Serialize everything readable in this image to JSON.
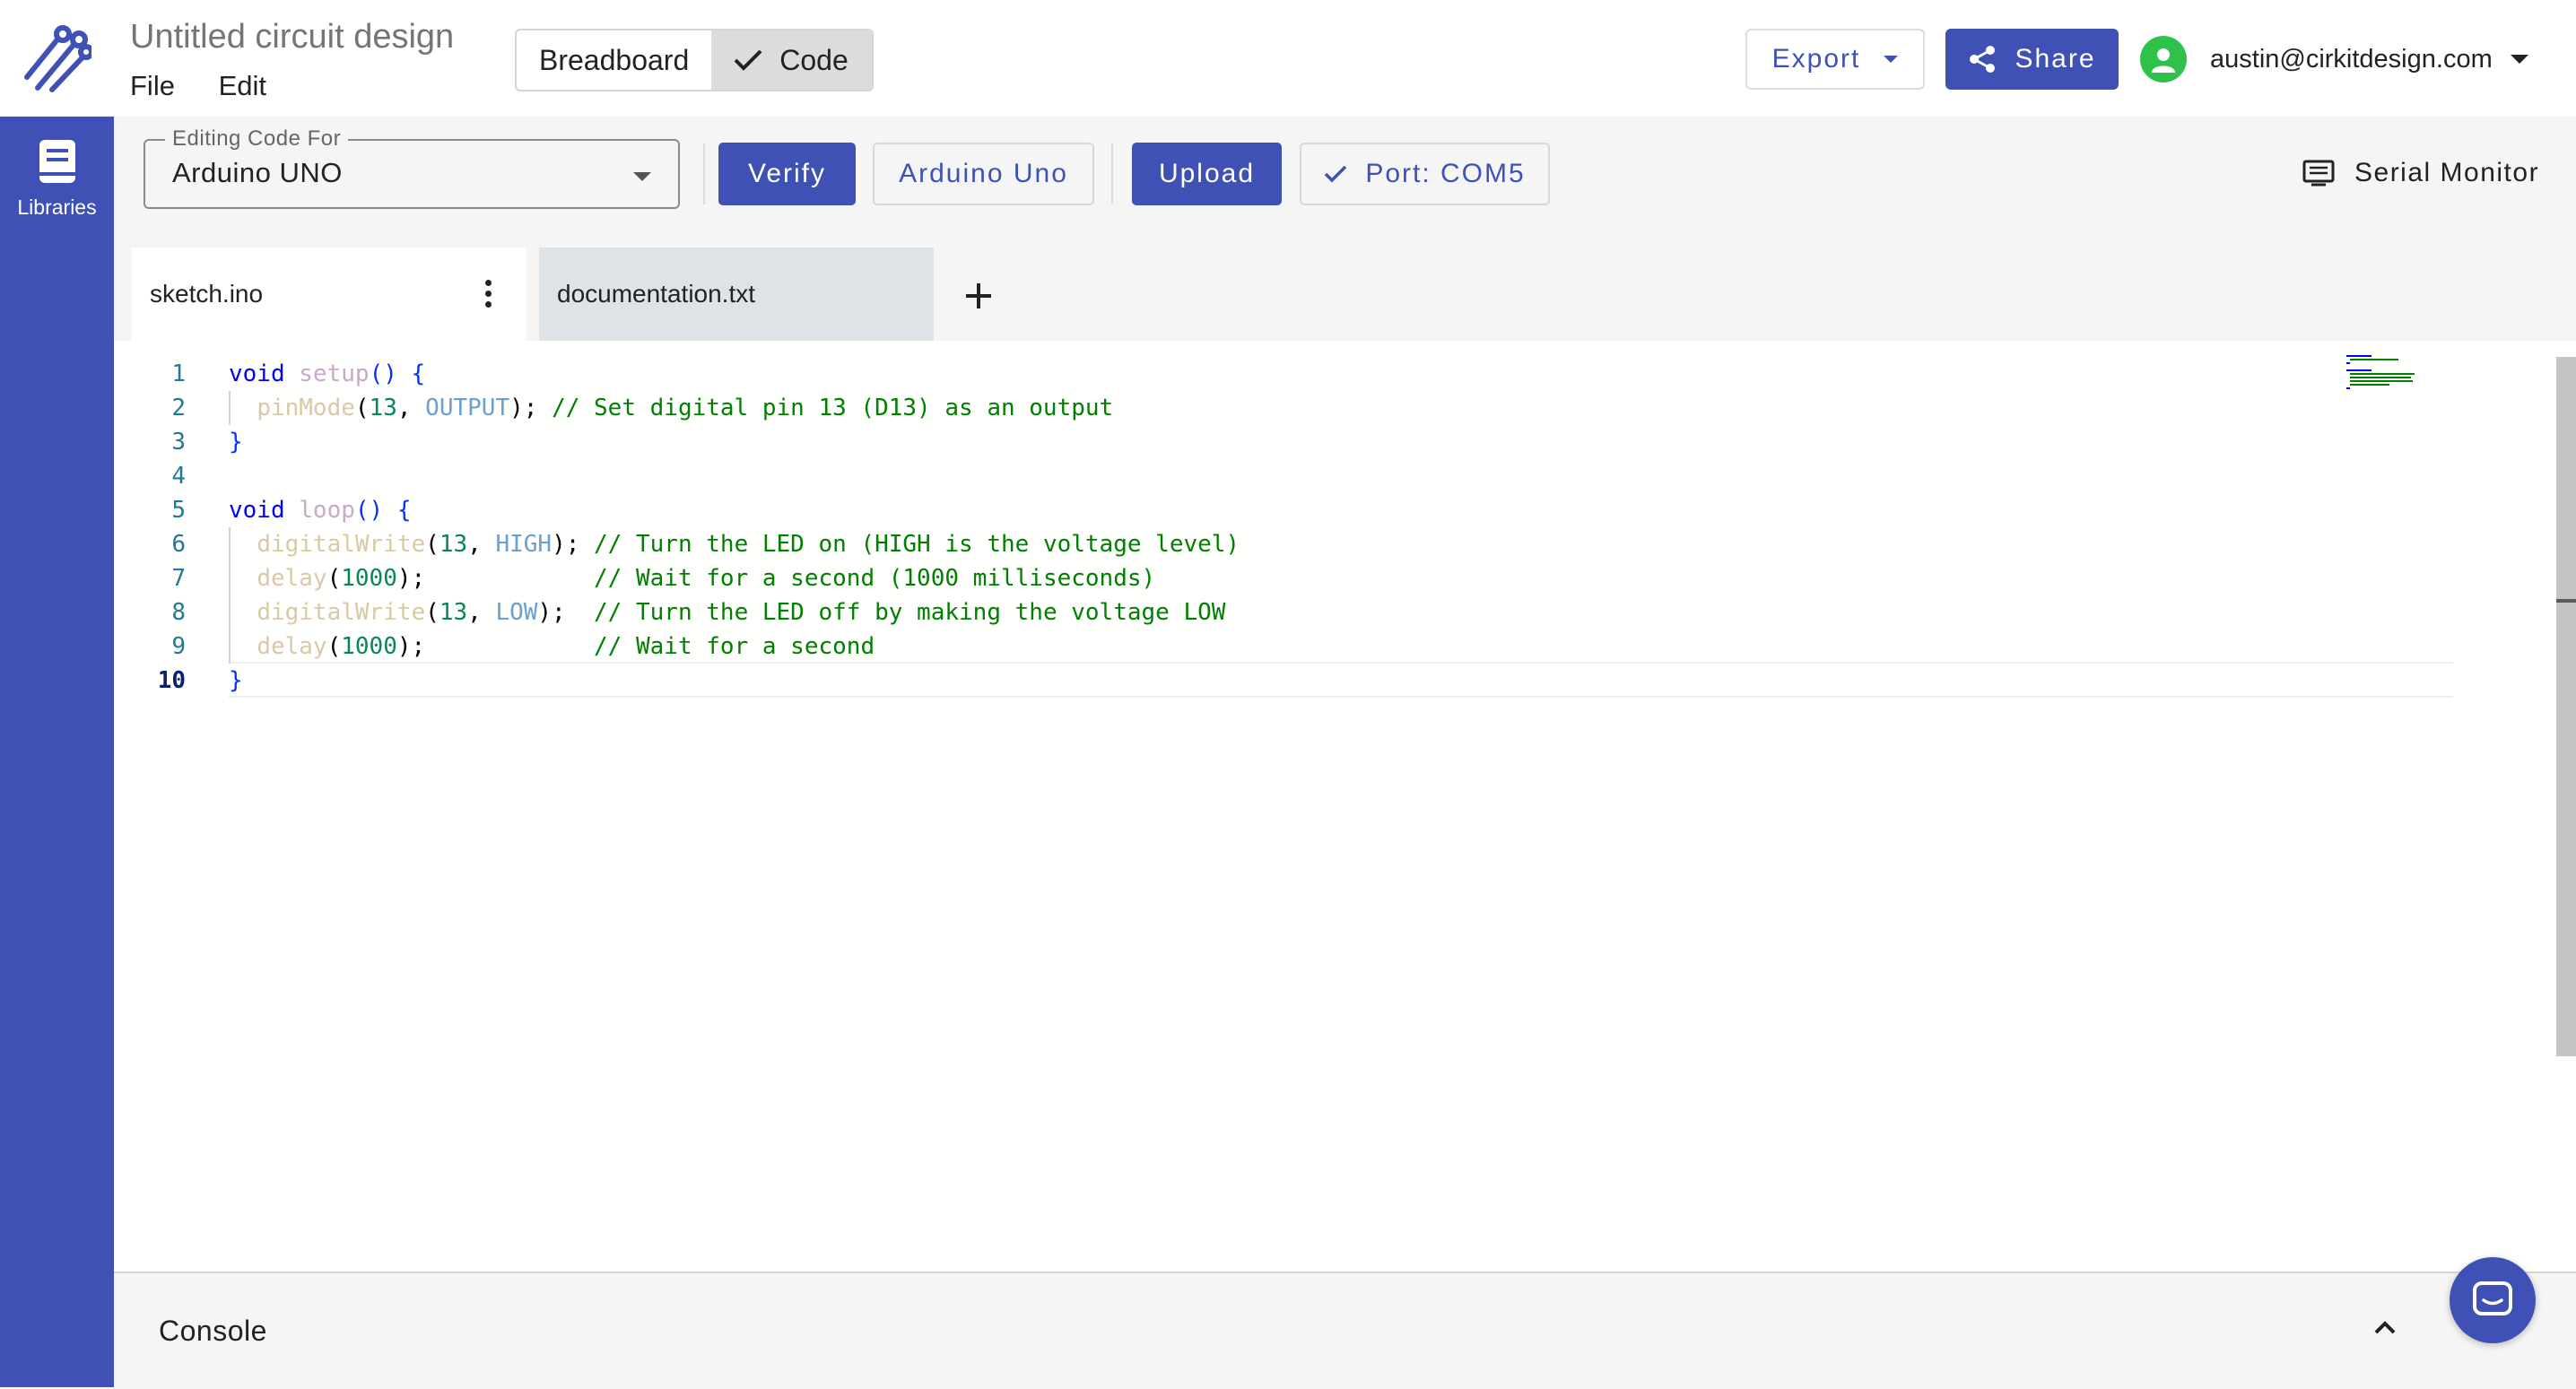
{
  "header": {
    "title": "Untitled circuit design",
    "menu": [
      "File",
      "Edit"
    ],
    "view_toggle": {
      "breadboard": "Breadboard",
      "code": "Code",
      "active": "Code"
    },
    "export_label": "Export",
    "share_label": "Share",
    "user_email": "austin@cirkitdesign.com"
  },
  "sidebar": {
    "libraries_label": "Libraries"
  },
  "toolbar": {
    "board_select_legend": "Editing Code For",
    "board_select_value": "Arduino UNO",
    "verify_label": "Verify",
    "board_label": "Arduino Uno",
    "upload_label": "Upload",
    "port_label": "Port: COM5",
    "serial_monitor_label": "Serial Monitor"
  },
  "tabs": [
    {
      "label": "sketch.ino",
      "active": true
    },
    {
      "label": "documentation.txt",
      "active": false
    }
  ],
  "editor": {
    "current_line": 10,
    "line_numbers": [
      "1",
      "2",
      "3",
      "4",
      "5",
      "6",
      "7",
      "8",
      "9",
      "10"
    ]
  },
  "console": {
    "label": "Console"
  },
  "colors": {
    "accent": "#3f51b5",
    "avatar": "#2ec24a",
    "comment": "#008000",
    "keyword": "#0000ff"
  }
}
